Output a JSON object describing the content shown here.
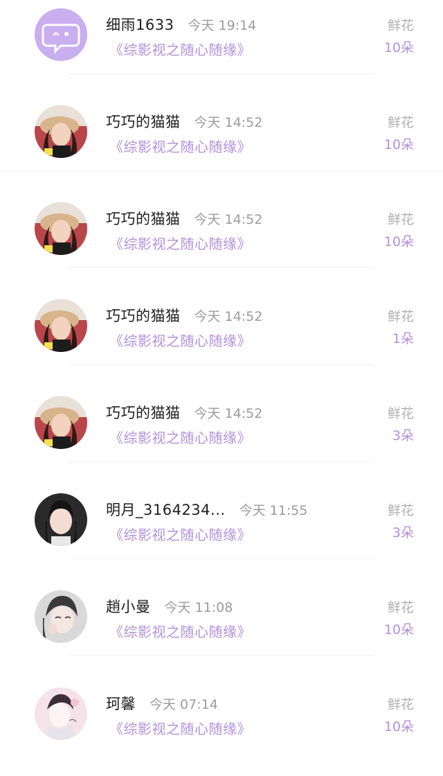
{
  "gift_entries": [
    {
      "name": "细雨1633",
      "time": "今天 19:14",
      "work": "《综影视之随心随缘》",
      "gift_label": "鲜花",
      "gift_count": "10朵",
      "avatar": "message-bubble-icon"
    },
    {
      "name": "巧巧的猫猫",
      "time": "今天 14:52",
      "work": "《综影视之随心随缘》",
      "gift_label": "鲜花",
      "gift_count": "10朵",
      "avatar": "user-photo"
    },
    {
      "name": "巧巧的猫猫",
      "time": "今天 14:52",
      "work": "《综影视之随心随缘》",
      "gift_label": "鲜花",
      "gift_count": "10朵",
      "avatar": "user-photo"
    },
    {
      "name": "巧巧的猫猫",
      "time": "今天 14:52",
      "work": "《综影视之随心随缘》",
      "gift_label": "鲜花",
      "gift_count": "1朵",
      "avatar": "user-photo"
    },
    {
      "name": "巧巧的猫猫",
      "time": "今天 14:52",
      "work": "《综影视之随心随缘》",
      "gift_label": "鲜花",
      "gift_count": "3朵",
      "avatar": "user-photo"
    },
    {
      "name": "明月_3164234...",
      "time": "今天 11:55",
      "work": "《综影视之随心随缘》",
      "gift_label": "鲜花",
      "gift_count": "3朵",
      "avatar": "user-photo"
    },
    {
      "name": "趙小曼",
      "time": "今天 11:08",
      "work": "《综影视之随心随缘》",
      "gift_label": "鲜花",
      "gift_count": "10朵",
      "avatar": "user-photo"
    },
    {
      "name": "珂馨",
      "time": "今天 07:14",
      "work": "《综影视之随心随缘》",
      "gift_label": "鲜花",
      "gift_count": "10朵",
      "avatar": "illustration"
    }
  ],
  "colors": {
    "accent": "#b291dd",
    "name": "#1e1e1e",
    "muted": "#9b9b9b",
    "avatar_placeholder": "#c9aef0"
  }
}
